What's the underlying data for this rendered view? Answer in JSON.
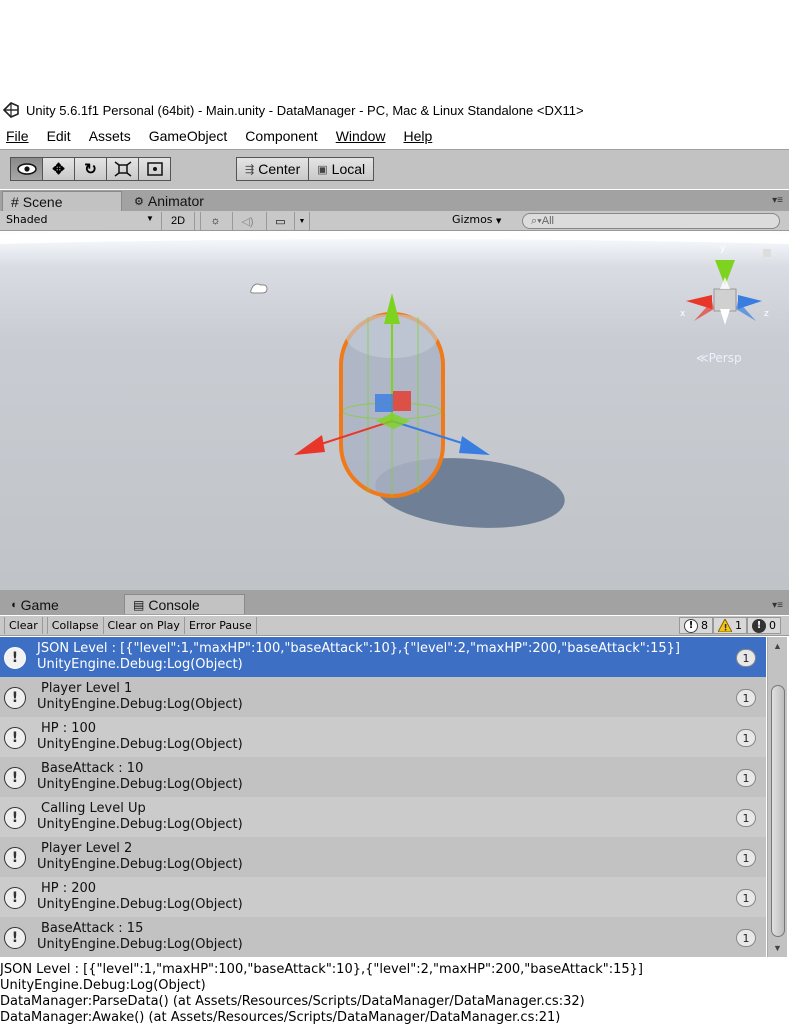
{
  "window": {
    "title": "Unity 5.6.1f1 Personal (64bit) - Main.unity - DataManager - PC, Mac & Linux Standalone <DX11>"
  },
  "menu": [
    "File",
    "Edit",
    "Assets",
    "GameObject",
    "Component",
    "Window",
    "Help"
  ],
  "toolbar": {
    "tools": [
      "hand-tool",
      "move-tool",
      "rotate-tool",
      "scale-tool",
      "rect-tool"
    ],
    "pivot_label": "Center",
    "space_label": "Local"
  },
  "scene_tabs": {
    "scene": "Scene",
    "animator": "Animator"
  },
  "scene_toolbar": {
    "shading_mode": "Shaded",
    "mode_2d": "2D",
    "gizmos_label": "Gizmos",
    "search_placeholder": "All"
  },
  "viewport": {
    "projection_label": "Persp",
    "axis_labels": {
      "x": "x",
      "y": "y",
      "z": "z"
    }
  },
  "console_tabs": {
    "game": "Game",
    "console": "Console"
  },
  "console_toolbar": {
    "clear": "Clear",
    "collapse": "Collapse",
    "clear_on_play": "Clear on Play",
    "error_pause": "Error Pause",
    "info_count": "8",
    "warning_count": "1",
    "error_count": "0"
  },
  "logs": [
    {
      "message": "JSON Level : [{\"level\":1,\"maxHP\":100,\"baseAttack\":10},{\"level\":2,\"maxHP\":200,\"baseAttack\":15}]",
      "source": "UnityEngine.Debug:Log(Object)",
      "count": "1",
      "selected": true
    },
    {
      "message": "Player Level 1",
      "source": "UnityEngine.Debug:Log(Object)",
      "count": "1"
    },
    {
      "message": "HP : 100",
      "source": "UnityEngine.Debug:Log(Object)",
      "count": "1"
    },
    {
      "message": "BaseAttack : 10",
      "source": "UnityEngine.Debug:Log(Object)",
      "count": "1"
    },
    {
      "message": "Calling Level Up",
      "source": "UnityEngine.Debug:Log(Object)",
      "count": "1"
    },
    {
      "message": "Player Level 2",
      "source": "UnityEngine.Debug:Log(Object)",
      "count": "1"
    },
    {
      "message": "HP : 200",
      "source": "UnityEngine.Debug:Log(Object)",
      "count": "1"
    },
    {
      "message": "BaseAttack : 15",
      "source": "UnityEngine.Debug:Log(Object)",
      "count": "1"
    }
  ],
  "details": [
    "JSON Level : [{\"level\":1,\"maxHP\":100,\"baseAttack\":10},{\"level\":2,\"maxHP\":200,\"baseAttack\":15}]",
    "UnityEngine.Debug:Log(Object)",
    "DataManager:ParseData() (at Assets/Resources/Scripts/DataManager/DataManager.cs:32)",
    "DataManager:Awake() (at Assets/Resources/Scripts/DataManager/DataManager.cs:21)"
  ],
  "colors": {
    "selection": "#3d6fc4",
    "selection_outline": "#f07a1a",
    "axis_x": "#e8372a",
    "axis_y": "#7ed321",
    "axis_z": "#3a7de0",
    "panel_bg": "#c2c2c2"
  }
}
